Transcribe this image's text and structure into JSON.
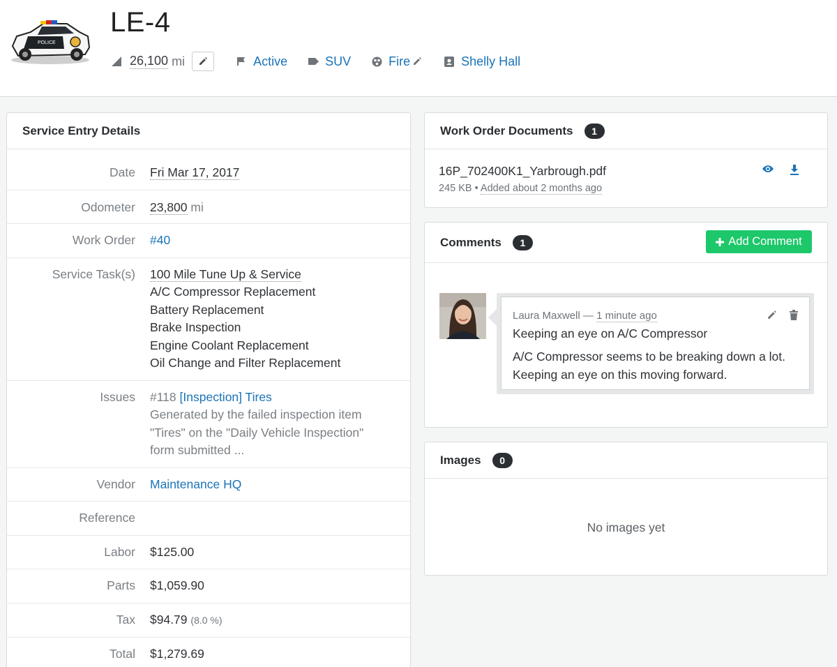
{
  "header": {
    "title": "LE-4",
    "odometer_value": "26,100",
    "odometer_unit": "mi",
    "status": "Active",
    "type": "SUV",
    "group": "Fire",
    "operator": "Shelly Hall",
    "icons": {
      "odometer": "odometer-icon",
      "edit": "pencil-icon",
      "status": "flag-icon",
      "type": "tag-icon",
      "group": "group-icon",
      "operator": "badge-icon"
    }
  },
  "service_entry": {
    "title": "Service Entry Details",
    "date_label": "Date",
    "date_value": "Fri Mar 17, 2017",
    "odometer_label": "Odometer",
    "odometer_value": "23,800",
    "odometer_unit": "mi",
    "work_order_label": "Work Order",
    "work_order_value": "#40",
    "tasks_label": "Service Task(s)",
    "tasks": [
      "100 Mile Tune Up & Service",
      "A/C Compressor Replacement",
      "Battery Replacement",
      "Brake Inspection",
      "Engine Coolant Replacement",
      "Oil Change and Filter Replacement"
    ],
    "issues_label": "Issues",
    "issue_number": "#118",
    "issue_link": "[Inspection] Tires",
    "issue_desc": "Generated by the failed inspection item \"Tires\" on the \"Daily Vehicle Inspection\" form submitted ...",
    "vendor_label": "Vendor",
    "vendor_value": "Maintenance HQ",
    "reference_label": "Reference",
    "labor_label": "Labor",
    "labor_value": "$125.00",
    "parts_label": "Parts",
    "parts_value": "$1,059.90",
    "tax_label": "Tax",
    "tax_value": "$94.79",
    "tax_rate": "(8.0 %)",
    "total_label": "Total",
    "total_value": "$1,279.69"
  },
  "documents": {
    "title": "Work Order Documents",
    "count": "1",
    "file_name": "16P_702400K1_Yarbrough.pdf",
    "file_size": "245 KB",
    "added": "Added about 2 months ago",
    "icons": {
      "view": "eye-icon",
      "download": "download-icon"
    }
  },
  "comments": {
    "title": "Comments",
    "count": "1",
    "add_button": "Add Comment",
    "author": "Laura Maxwell",
    "time": "1 minute ago",
    "comment_title": "Keeping an eye on A/C Compressor",
    "comment_body": "A/C Compressor seems to be breaking down a lot. Keeping an eye on this moving forward.",
    "icons": {
      "edit": "pencil-icon",
      "delete": "trash-icon",
      "add": "plus-icon"
    }
  },
  "images": {
    "title": "Images",
    "count": "0",
    "empty": "No images yet"
  },
  "colors": {
    "link": "#1a73b8",
    "accent_green": "#1dc86b",
    "badge": "#2b2f33"
  }
}
